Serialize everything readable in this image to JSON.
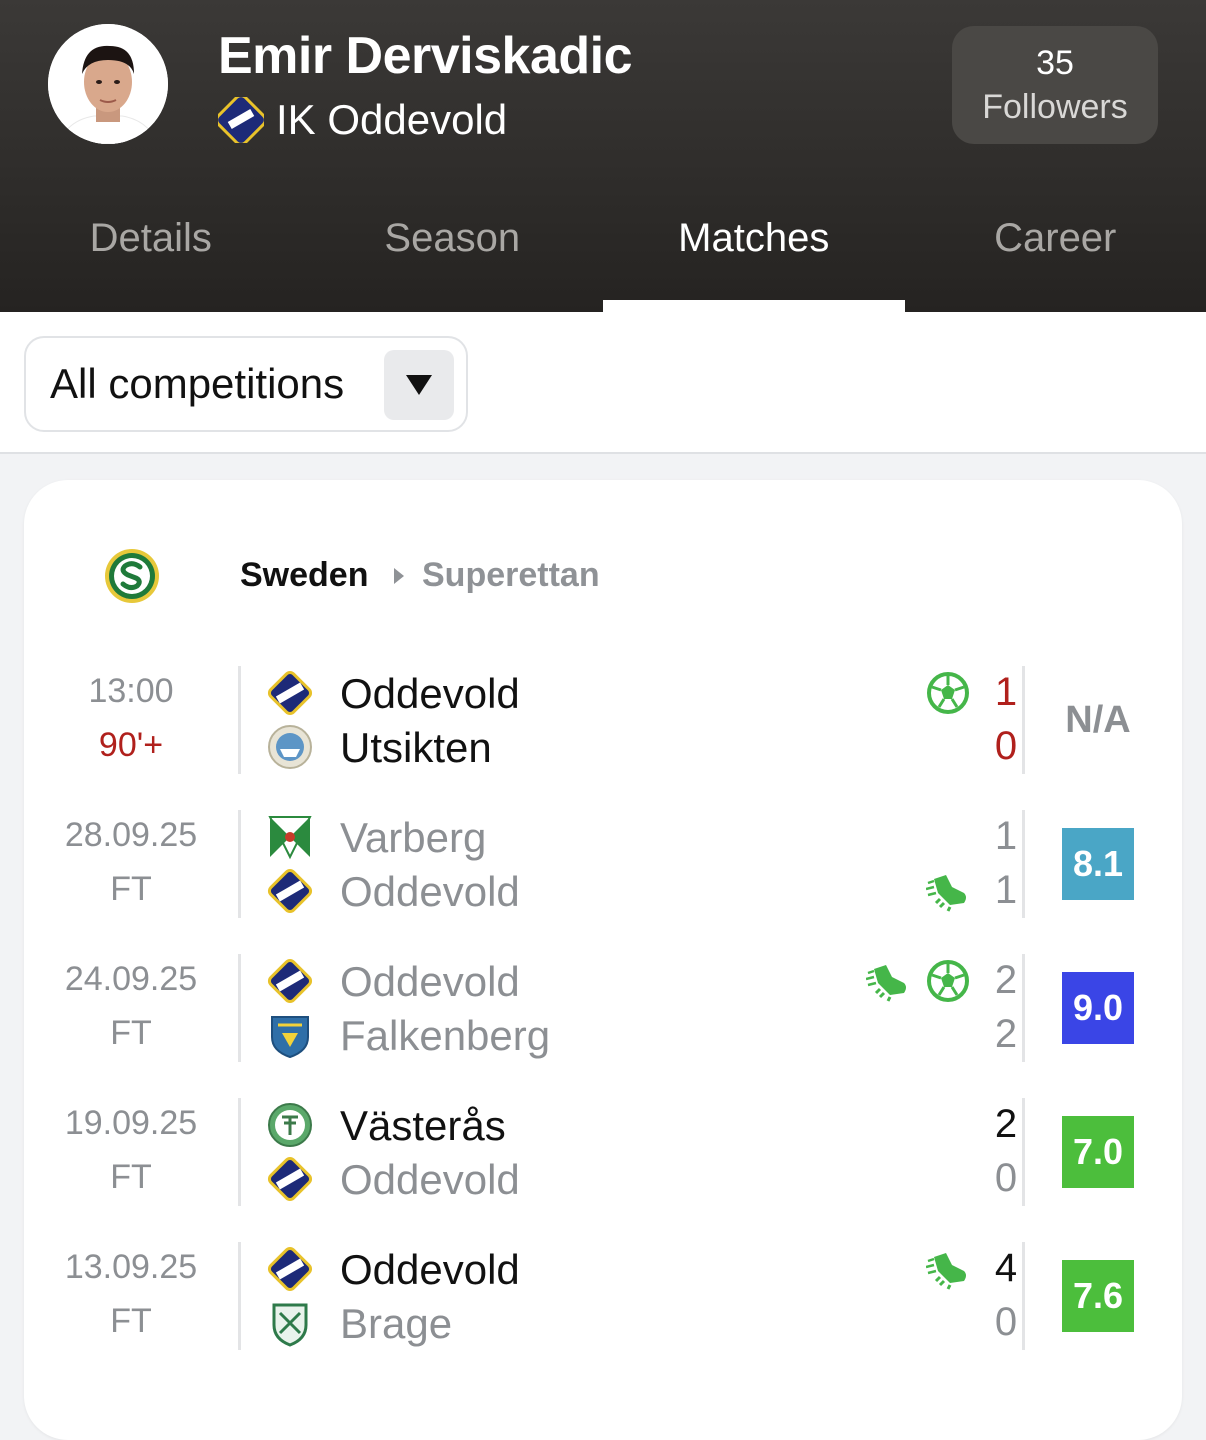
{
  "player": {
    "name": "Emir Derviskadic",
    "club": "IK Oddevold",
    "followers_count": "35",
    "followers_label": "Followers"
  },
  "tabs": [
    {
      "label": "Details",
      "active": false
    },
    {
      "label": "Season",
      "active": false
    },
    {
      "label": "Matches",
      "active": true
    },
    {
      "label": "Career",
      "active": false
    }
  ],
  "filter": {
    "selected": "All competitions"
  },
  "league": {
    "country": "Sweden",
    "name": "Superettan"
  },
  "matches": [
    {
      "date": "13:00",
      "status": "90'+",
      "live": true,
      "home": {
        "name": "Oddevold",
        "score": "1",
        "bold": true
      },
      "away": {
        "name": "Utsikten",
        "score": "0",
        "bold": true
      },
      "rating": "N/A",
      "rating_color": null
    },
    {
      "date": "28.09.25",
      "status": "FT",
      "live": false,
      "home": {
        "name": "Varberg",
        "score": "1",
        "bold": false
      },
      "away": {
        "name": "Oddevold",
        "score": "1",
        "bold": false
      },
      "rating": "8.1",
      "rating_color": "#4aa6c6"
    },
    {
      "date": "24.09.25",
      "status": "FT",
      "live": false,
      "home": {
        "name": "Oddevold",
        "score": "2",
        "bold": false
      },
      "away": {
        "name": "Falkenberg",
        "score": "2",
        "bold": false
      },
      "rating": "9.0",
      "rating_color": "#3a45e6"
    },
    {
      "date": "19.09.25",
      "status": "FT",
      "live": false,
      "home": {
        "name": "Västerås",
        "score": "2",
        "bold": true
      },
      "away": {
        "name": "Oddevold",
        "score": "0",
        "bold": false
      },
      "rating": "7.0",
      "rating_color": "#4cbe3c"
    },
    {
      "date": "13.09.25",
      "status": "FT",
      "live": false,
      "home": {
        "name": "Oddevold",
        "score": "4",
        "bold": true
      },
      "away": {
        "name": "Brage",
        "score": "0",
        "bold": false
      },
      "rating": "7.6",
      "rating_color": "#4cbe3c"
    }
  ],
  "colors": {
    "event_green": "#45b649",
    "live_red": "#b0201c"
  }
}
